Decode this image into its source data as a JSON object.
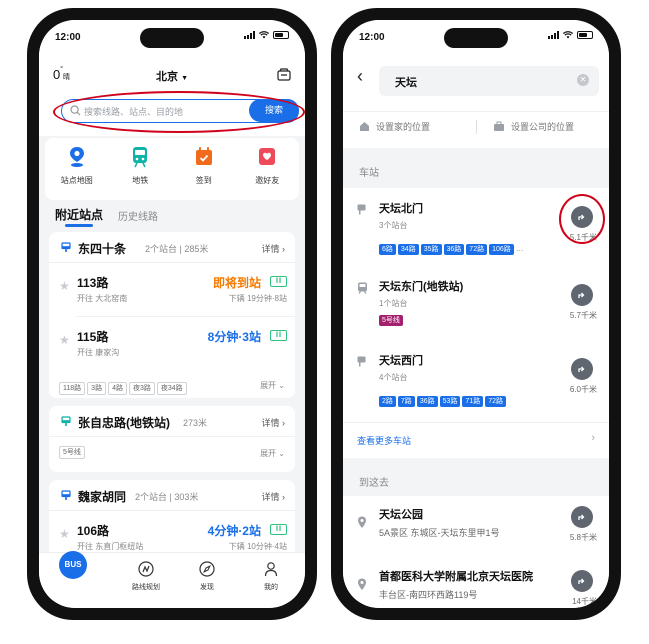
{
  "left": {
    "status": {
      "time": "12:00"
    },
    "header": {
      "temp": "0",
      "temp_unit": "°",
      "weather": "晴",
      "city": "北京"
    },
    "search": {
      "placeholder": "搜索线路、站点、目的地",
      "button": "搜索"
    },
    "quick": [
      {
        "label": "站点地图",
        "icon": "location-pin-icon"
      },
      {
        "label": "地铁",
        "icon": "subway-icon"
      },
      {
        "label": "签到",
        "icon": "calendar-check-icon"
      },
      {
        "label": "邀好友",
        "icon": "gift-icon"
      }
    ],
    "tabs": {
      "active": "附近站点",
      "inactive": "历史线路"
    },
    "stations": [
      {
        "name": "东四十条",
        "meta": "2个站台 | 285米",
        "detail": "详情",
        "routes": [
          {
            "name": "113路",
            "dir": "开往 大北窑南",
            "eta": "即将到站",
            "eta_color": "orange",
            "next": "下辆  19分钟·8站"
          },
          {
            "name": "115路",
            "dir": "开往 康家沟",
            "eta": "8分钟·3站",
            "eta_color": "blue",
            "next": ""
          }
        ],
        "chips": [
          "118路",
          "3路",
          "4路",
          "夜3路",
          "夜34路"
        ],
        "expand": "展开"
      },
      {
        "name": "张自忠路(地铁站)",
        "meta": "273米",
        "detail": "详情",
        "chips": [
          "5号线"
        ],
        "expand": "展开"
      },
      {
        "name": "魏家胡同",
        "meta": "2个站台 | 303米",
        "detail": "详情",
        "routes": [
          {
            "name": "106路",
            "dir": "开往 东直门枢纽站",
            "eta": "4分钟·2站",
            "eta_color": "blue",
            "next": "下辆  10分钟·4站"
          }
        ]
      }
    ],
    "bottom_nav": [
      {
        "label": "BUS",
        "icon": "bus-icon"
      },
      {
        "label": "路线规划",
        "icon": "route-icon"
      },
      {
        "label": "发现",
        "icon": "compass-icon"
      },
      {
        "label": "我的",
        "icon": "person-icon"
      }
    ]
  },
  "right": {
    "status": {
      "time": "12:00"
    },
    "search": {
      "value": "天坛"
    },
    "shortcuts": {
      "home": "设置家的位置",
      "work": "设置公司的位置"
    },
    "section_station": "车站",
    "stations": [
      {
        "name": "天坛北门",
        "sub": "3个站台",
        "lines": [
          "6路",
          "34路",
          "35路",
          "36路",
          "72路",
          "106路"
        ],
        "more": true,
        "distance": "5.1千米",
        "type": "bus"
      },
      {
        "name": "天坛东门(地铁站)",
        "sub": "1个站台",
        "subway_line": "5号线",
        "distance": "5.7千米",
        "type": "subway"
      },
      {
        "name": "天坛西门",
        "sub": "4个站台",
        "lines": [
          "2路",
          "7路",
          "36路",
          "53路",
          "71路",
          "72路"
        ],
        "more": false,
        "distance": "6.0千米",
        "type": "bus"
      }
    ],
    "more_stations": "查看更多车站",
    "section_destination": "到这去",
    "places": [
      {
        "name": "天坛公园",
        "addr": "5A景区 东城区-天坛东里甲1号",
        "distance": "5.8千米"
      },
      {
        "name": "首都医科大学附属北京天坛医院",
        "addr": "丰台区-南四环西路119号",
        "distance": "14千米"
      }
    ]
  },
  "colors": {
    "accent": "#1a6fe8",
    "orange": "#f47a00",
    "highlight_ring": "#d0021b",
    "subway_purple": "#a3206e"
  }
}
